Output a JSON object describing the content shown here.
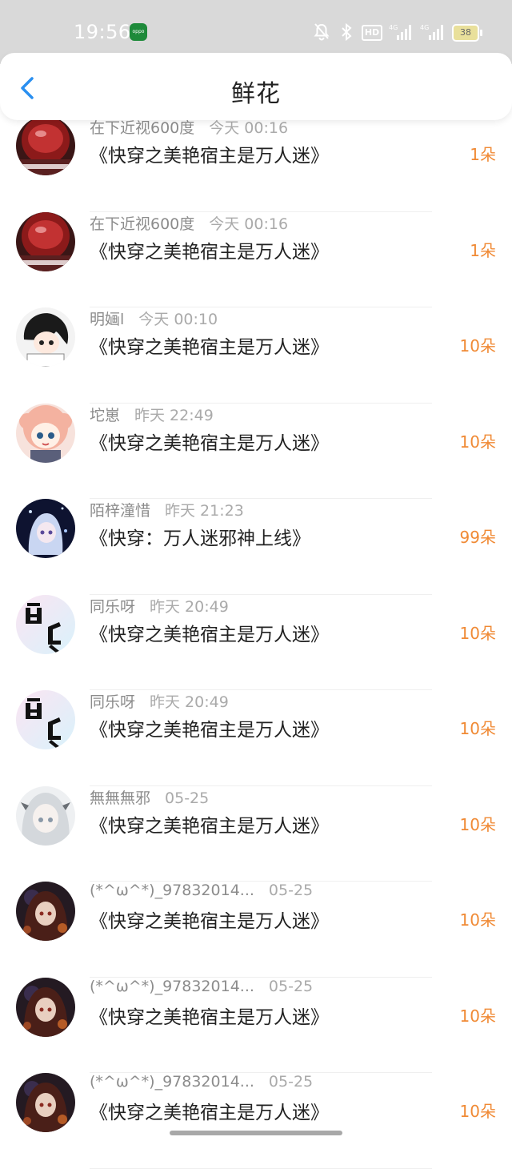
{
  "status_bar": {
    "time": "19:56",
    "app_icon": "oppo-app-icon",
    "network1": "4G",
    "network2": "4G",
    "battery": "38",
    "hd_label": "HD"
  },
  "nav": {
    "title": "鲜花",
    "back_icon": "chevron-left-icon"
  },
  "colors": {
    "accent": "#f08a35",
    "back": "#2a8ff0",
    "status_bg": "#d9d9d9"
  },
  "flowers": [
    {
      "user": "在下近视600度",
      "time": "今天 00:16",
      "book": "《快穿之美艳宿主是万人迷》",
      "count": "1朵",
      "avatar": "red-bottle-avatar"
    },
    {
      "user": "在下近视600度",
      "time": "今天 00:16",
      "book": "《快穿之美艳宿主是万人迷》",
      "count": "1朵",
      "avatar": "red-bottle-avatar"
    },
    {
      "user": "明婳l",
      "time": "今天 00:10",
      "book": "《快穿之美艳宿主是万人迷》",
      "count": "10朵",
      "avatar": "anime-boy-avatar"
    },
    {
      "user": "坨崽",
      "time": "昨天 22:49",
      "book": "《快穿之美艳宿主是万人迷》",
      "count": "10朵",
      "avatar": "pink-hair-girl-avatar"
    },
    {
      "user": "陌梓潼惜",
      "time": "昨天 21:23",
      "book": "《快穿：万人迷邪神上线》",
      "count": "99朵",
      "avatar": "night-anime-girl-avatar"
    },
    {
      "user": "同乐呀",
      "time": "昨天 20:49",
      "book": "《快穿之美艳宿主是万人迷》",
      "count": "10朵",
      "avatar": "calligraphy-avatar"
    },
    {
      "user": "同乐呀",
      "time": "昨天 20:49",
      "book": "《快穿之美艳宿主是万人迷》",
      "count": "10朵",
      "avatar": "calligraphy-avatar"
    },
    {
      "user": "無無無邪",
      "time": "05-25",
      "book": "《快穿之美艳宿主是万人迷》",
      "count": "10朵",
      "avatar": "white-hair-girl-avatar"
    },
    {
      "user": "(*^ω^*)_97832014...",
      "time": "05-25",
      "book": "《快穿之美艳宿主是万人迷》",
      "count": "10朵",
      "avatar": "dark-anime-avatar"
    },
    {
      "user": "(*^ω^*)_97832014...",
      "time": "05-25",
      "book": "《快穿之美艳宿主是万人迷》",
      "count": "10朵",
      "avatar": "dark-anime-avatar"
    },
    {
      "user": "(*^ω^*)_97832014...",
      "time": "05-25",
      "book": "《快穿之美艳宿主是万人迷》",
      "count": "10朵",
      "avatar": "dark-anime-avatar"
    }
  ]
}
